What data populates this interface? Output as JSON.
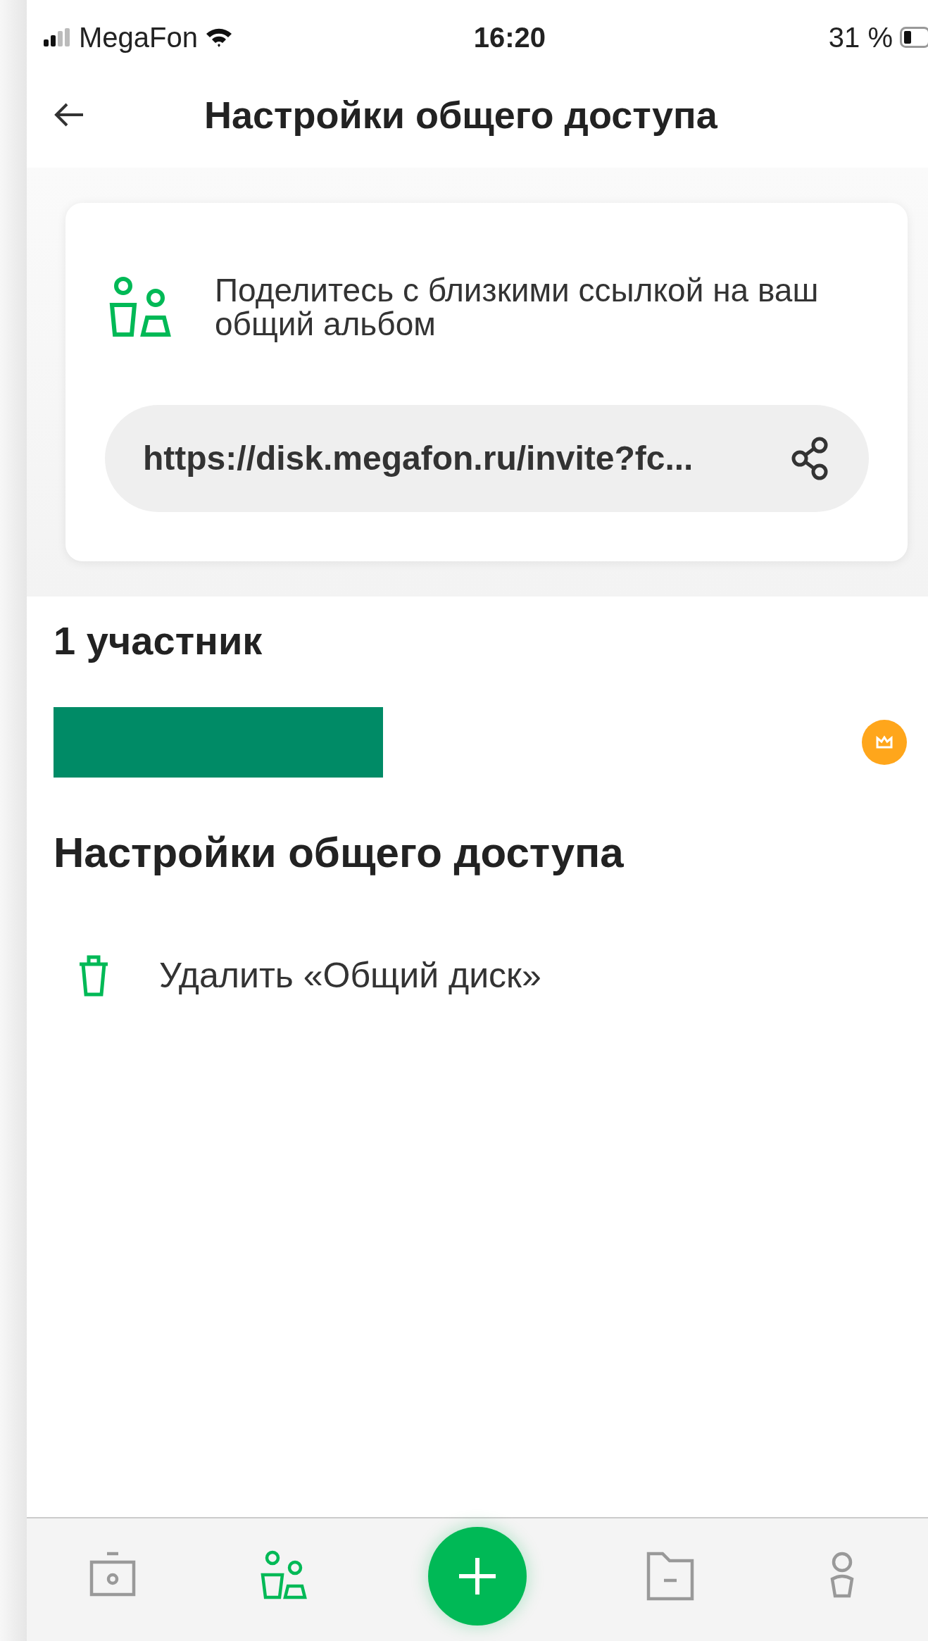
{
  "status_bar": {
    "carrier": "MegaFon",
    "time": "16:20",
    "battery": "31 %"
  },
  "header": {
    "title": "Настройки общего доступа"
  },
  "invite_card": {
    "text": "Поделитесь с близкими ссылкой на ваш общий альбом",
    "link": "https://disk.megafon.ru/invite?fc..."
  },
  "members": {
    "count": "1 участник",
    "items": [
      {
        "owner": true
      }
    ]
  },
  "settings": {
    "title": "Настройки общего доступа",
    "actions": [
      {
        "kind": "delete",
        "label": "Удалить «Общий диск»"
      }
    ]
  },
  "tab_bar": [
    {
      "kind": "camera",
      "selected": false
    },
    {
      "kind": "people",
      "selected": true
    },
    {
      "kind": "add",
      "selected": false
    },
    {
      "kind": "folder",
      "selected": false
    },
    {
      "kind": "profile",
      "selected": false
    }
  ]
}
